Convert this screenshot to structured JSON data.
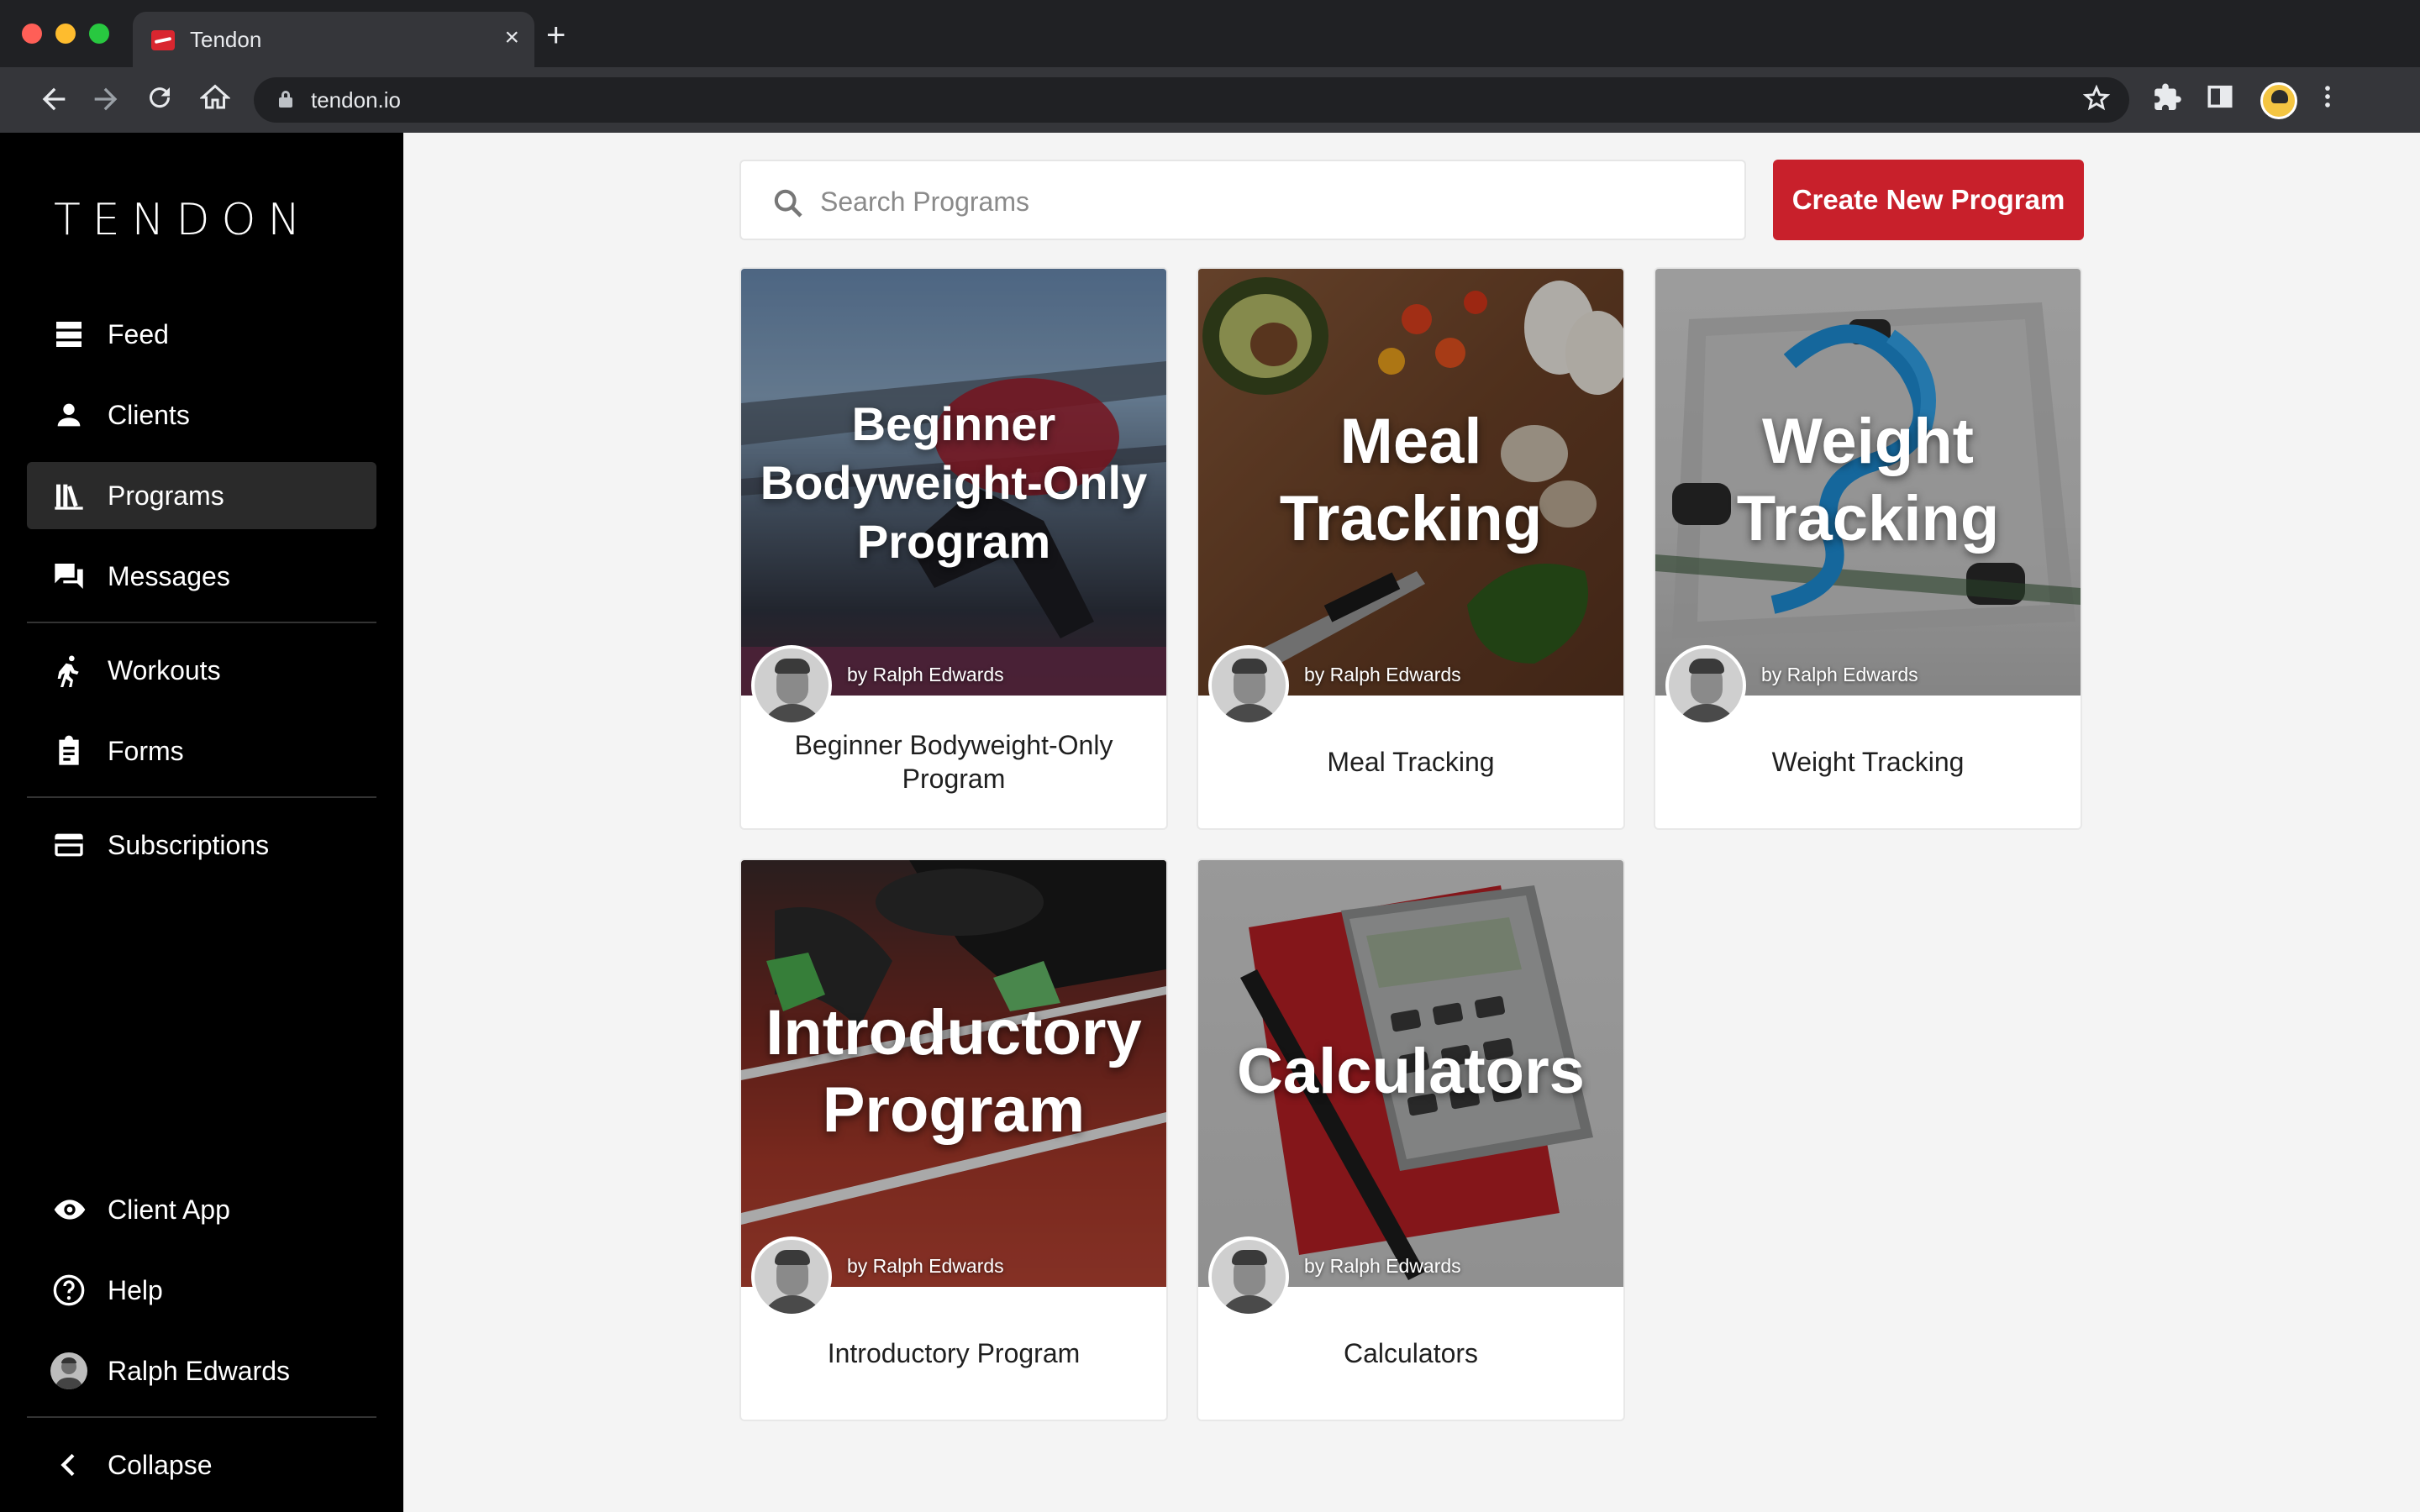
{
  "browser": {
    "tab_title": "Tendon",
    "tab_close": "×",
    "new_tab": "+",
    "url": "tendon.io"
  },
  "sidebar": {
    "logo": "TENDON",
    "items": [
      {
        "label": "Feed",
        "icon": "feed-icon",
        "active": false
      },
      {
        "label": "Clients",
        "icon": "person-icon",
        "active": false
      },
      {
        "label": "Programs",
        "icon": "library-icon",
        "active": true
      },
      {
        "label": "Messages",
        "icon": "chat-icon",
        "active": false
      },
      {
        "label": "Workouts",
        "icon": "running-icon",
        "active": false
      },
      {
        "label": "Forms",
        "icon": "clipboard-icon",
        "active": false
      },
      {
        "label": "Subscriptions",
        "icon": "credit-card-icon",
        "active": false
      }
    ],
    "bottom": [
      {
        "label": "Client App",
        "icon": "eye-icon"
      },
      {
        "label": "Help",
        "icon": "help-icon"
      },
      {
        "label": "Ralph Edwards",
        "icon": "avatar"
      },
      {
        "label": "Collapse",
        "icon": "chevron-left-icon"
      }
    ]
  },
  "main": {
    "search_placeholder": "Search Programs",
    "create_button": "Create New Program",
    "programs": [
      {
        "overlay_title": "Beginner Bodyweight-Only Program",
        "author": "by Ralph Edwards",
        "caption": "Beginner Bodyweight-Only Program"
      },
      {
        "overlay_title": "Meal Tracking",
        "author": "by Ralph Edwards",
        "caption": "Meal Tracking"
      },
      {
        "overlay_title": "Weight Tracking",
        "author": "by Ralph Edwards",
        "caption": "Weight Tracking"
      },
      {
        "overlay_title": "Introductory Program",
        "author": "by Ralph Edwards",
        "caption": "Introductory Program"
      },
      {
        "overlay_title": "Calculators",
        "author": "by Ralph Edwards",
        "caption": "Calculators"
      }
    ]
  },
  "colors": {
    "brand_red": "#c8202b",
    "sidebar_bg": "#000000",
    "sidebar_active": "#2a2a2a",
    "page_bg": "#f4f4f4"
  }
}
